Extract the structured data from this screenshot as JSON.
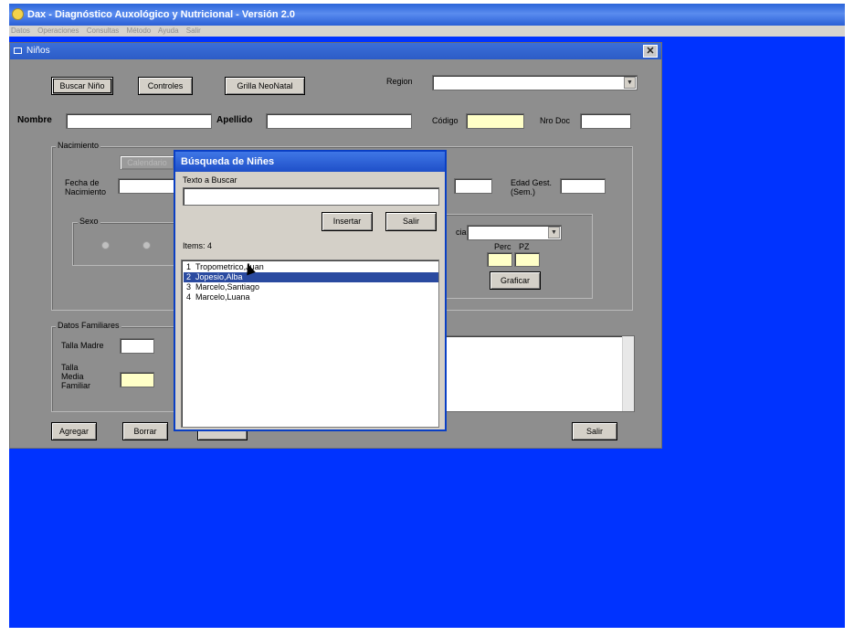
{
  "app": {
    "title": "Dax - Diagnóstico Auxológico y Nutricional - Versión 2.0",
    "menu": [
      "Datos",
      "Operaciones",
      "Consultas",
      "Método",
      "Ayuda",
      "Salir"
    ]
  },
  "ninos": {
    "title": "Niños",
    "close": "✕",
    "buttons": {
      "buscar": "Buscar Niño",
      "controles": "Controles",
      "grilla": "Grilla NeoNatal"
    },
    "region_label": "Region",
    "nombre_label": "Nombre",
    "apellido_label": "Apellido",
    "codigo_label": "Código",
    "nrodoc_label": "Nro Doc",
    "nacimiento_group": "Nacimiento",
    "calendario": "Calendario",
    "fecha_nac_label": "Fecha de\nNacimiento",
    "edad_gest_label": "Edad Gest.\n(Sem.)",
    "sexo_group": "Sexo",
    "referencia_label": "cia",
    "perc_label": "Perc",
    "pz_label": "PZ",
    "graficar": "Graficar",
    "datos_familiares_group": "Datos Familiares",
    "talla_madre_label": "Talla Madre",
    "talla_media_label": "Talla\nMedia\nFamiliar",
    "bottom_buttons": {
      "agregar": "Agregar",
      "borrar": "Borrar",
      "salir": "Salir"
    }
  },
  "dialog": {
    "title": "Búsqueda de Niñes",
    "texto_label": "Texto a Buscar",
    "insertar": "Insertar",
    "salir": "Salir",
    "items_label": "Items: 4",
    "results": [
      {
        "num": "1",
        "name": "Tropometrico,Juan"
      },
      {
        "num": "2",
        "name": "Jopesio,Alba"
      },
      {
        "num": "3",
        "name": "Marcelo,Santiago"
      },
      {
        "num": "4",
        "name": "Marcelo,Luana"
      }
    ],
    "selected_index": 1
  }
}
